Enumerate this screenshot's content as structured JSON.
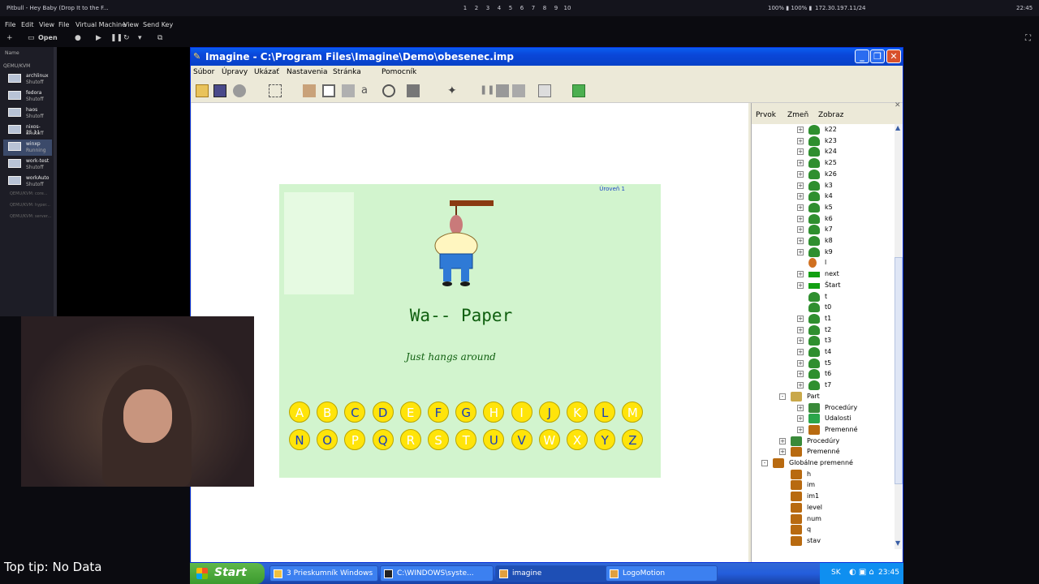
{
  "topbar": {
    "now_playing": "Pitbull - Hey Baby (Drop It to the F...",
    "workspaces": [
      "1",
      "2",
      "3",
      "4",
      "5",
      "6",
      "7",
      "8",
      "9",
      "10"
    ],
    "stats": "100% ▮ 100% ▮",
    "ip": "172.30.197.11/24",
    "clock": "22:45"
  },
  "host": {
    "menu": [
      "File",
      "Edit",
      "View",
      "File",
      "Virtual Machine",
      "View",
      "Send Key"
    ],
    "toolbar_open": "Open",
    "sidebar_title": "Name",
    "group1": "QEMU/KVM",
    "vms": [
      {
        "name": "archlinux",
        "status": "Shutoff"
      },
      {
        "name": "fedora",
        "status": "Shutoff"
      },
      {
        "name": "haos",
        "status": "Shutoff"
      },
      {
        "name": "nixos-25.11",
        "status": "Shutoff"
      },
      {
        "name": "winxp",
        "status": "Running"
      },
      {
        "name": "work-test",
        "status": "Shutoff"
      },
      {
        "name": "workAuto",
        "status": "Shutoff"
      }
    ],
    "groups": [
      "QEMU/KVM: core...",
      "QEMU/KVM: hyper...",
      "QEMU/KVM: server..."
    ]
  },
  "window": {
    "title": "Imagine - C:\\Program Files\\Imagine\\Demo\\obesenec.imp",
    "menu": [
      "Súbor",
      "Úpravy",
      "Ukázať",
      "Nastavenia",
      "Stránka",
      "Pomocník"
    ]
  },
  "game": {
    "level": "Úroveň 1",
    "word": "Wa-- Paper",
    "hint": "Just hangs around",
    "row1": [
      "A",
      "B",
      "C",
      "D",
      "E",
      "F",
      "G",
      "H",
      "I",
      "J",
      "K",
      "L",
      "M"
    ],
    "row2": [
      "N",
      "O",
      "P",
      "Q",
      "R",
      "S",
      "T",
      "U",
      "V",
      "W",
      "X",
      "Y",
      "Z"
    ],
    "used": [
      "A",
      "B",
      "E",
      "H",
      "I",
      "K",
      "M",
      "P",
      "R",
      "S",
      "T",
      "W",
      "X"
    ]
  },
  "panel": {
    "tabs": [
      "Prvok",
      "Zmeň",
      "Zobraz"
    ],
    "tree": [
      {
        "label": "k22",
        "level": 2,
        "pm": "+",
        "icon": "turtle"
      },
      {
        "label": "k23",
        "level": 2,
        "pm": "+",
        "icon": "turtle"
      },
      {
        "label": "k24",
        "level": 2,
        "pm": "+",
        "icon": "turtle"
      },
      {
        "label": "k25",
        "level": 2,
        "pm": "+",
        "icon": "turtle"
      },
      {
        "label": "k26",
        "level": 2,
        "pm": "+",
        "icon": "turtle"
      },
      {
        "label": "k3",
        "level": 2,
        "pm": "+",
        "icon": "turtle"
      },
      {
        "label": "k4",
        "level": 2,
        "pm": "+",
        "icon": "turtle"
      },
      {
        "label": "k5",
        "level": 2,
        "pm": "+",
        "icon": "turtle"
      },
      {
        "label": "k6",
        "level": 2,
        "pm": "+",
        "icon": "turtle"
      },
      {
        "label": "k7",
        "level": 2,
        "pm": "+",
        "icon": "turtle"
      },
      {
        "label": "k8",
        "level": 2,
        "pm": "+",
        "icon": "turtle"
      },
      {
        "label": "k9",
        "level": 2,
        "pm": "+",
        "icon": "turtle"
      },
      {
        "label": "l",
        "level": 2,
        "pm": "",
        "icon": "text"
      },
      {
        "label": "next",
        "level": 2,
        "pm": "+",
        "icon": "button"
      },
      {
        "label": "Štart",
        "level": 2,
        "pm": "+",
        "icon": "button"
      },
      {
        "label": "t",
        "level": 2,
        "pm": "",
        "icon": "turtle"
      },
      {
        "label": "t0",
        "level": 2,
        "pm": "",
        "icon": "turtle"
      },
      {
        "label": "t1",
        "level": 2,
        "pm": "+",
        "icon": "turtle"
      },
      {
        "label": "t2",
        "level": 2,
        "pm": "+",
        "icon": "turtle"
      },
      {
        "label": "t3",
        "level": 2,
        "pm": "+",
        "icon": "turtle"
      },
      {
        "label": "t4",
        "level": 2,
        "pm": "+",
        "icon": "turtle"
      },
      {
        "label": "t5",
        "level": 2,
        "pm": "+",
        "icon": "turtle"
      },
      {
        "label": "t6",
        "level": 2,
        "pm": "+",
        "icon": "turtle"
      },
      {
        "label": "t7",
        "level": 2,
        "pm": "+",
        "icon": "turtle"
      },
      {
        "label": "Part",
        "level": 1,
        "pm": "-",
        "icon": "part"
      },
      {
        "label": "Procedúry",
        "level": 2,
        "pm": "+",
        "icon": "procs"
      },
      {
        "label": "Udalosti",
        "level": 2,
        "pm": "+",
        "icon": "events"
      },
      {
        "label": "Premenné",
        "level": 2,
        "pm": "+",
        "icon": "vars"
      },
      {
        "label": "Procedúry",
        "level": 1,
        "pm": "+",
        "icon": "procs"
      },
      {
        "label": "Premenné",
        "level": 1,
        "pm": "+",
        "icon": "vars"
      },
      {
        "label": "Globálne premenné",
        "level": 0,
        "pm": "-",
        "icon": "vars"
      },
      {
        "label": "h",
        "level": 1,
        "pm": "",
        "icon": "vars"
      },
      {
        "label": "im",
        "level": 1,
        "pm": "",
        "icon": "vars"
      },
      {
        "label": "im1",
        "level": 1,
        "pm": "",
        "icon": "vars"
      },
      {
        "label": "level",
        "level": 1,
        "pm": "",
        "icon": "vars"
      },
      {
        "label": "num",
        "level": 1,
        "pm": "",
        "icon": "vars"
      },
      {
        "label": "q",
        "level": 1,
        "pm": "",
        "icon": "vars"
      },
      {
        "label": "stav",
        "level": 1,
        "pm": "",
        "icon": "vars"
      }
    ]
  },
  "taskbar": {
    "start": "Start",
    "tasks": [
      "3 Prieskumník Windows",
      "C:\\WINDOWS\\syste...",
      "imagine",
      "LogoMotion"
    ],
    "lang": "SK",
    "time": "23:45"
  },
  "overlay": {
    "tip": "Top tip: No Data"
  },
  "colors": {
    "game_bg": "#d2f4ce",
    "letter": "#ffe40a",
    "letter_text": "#1a3fb8",
    "xp_title": "#0a5ef0"
  }
}
